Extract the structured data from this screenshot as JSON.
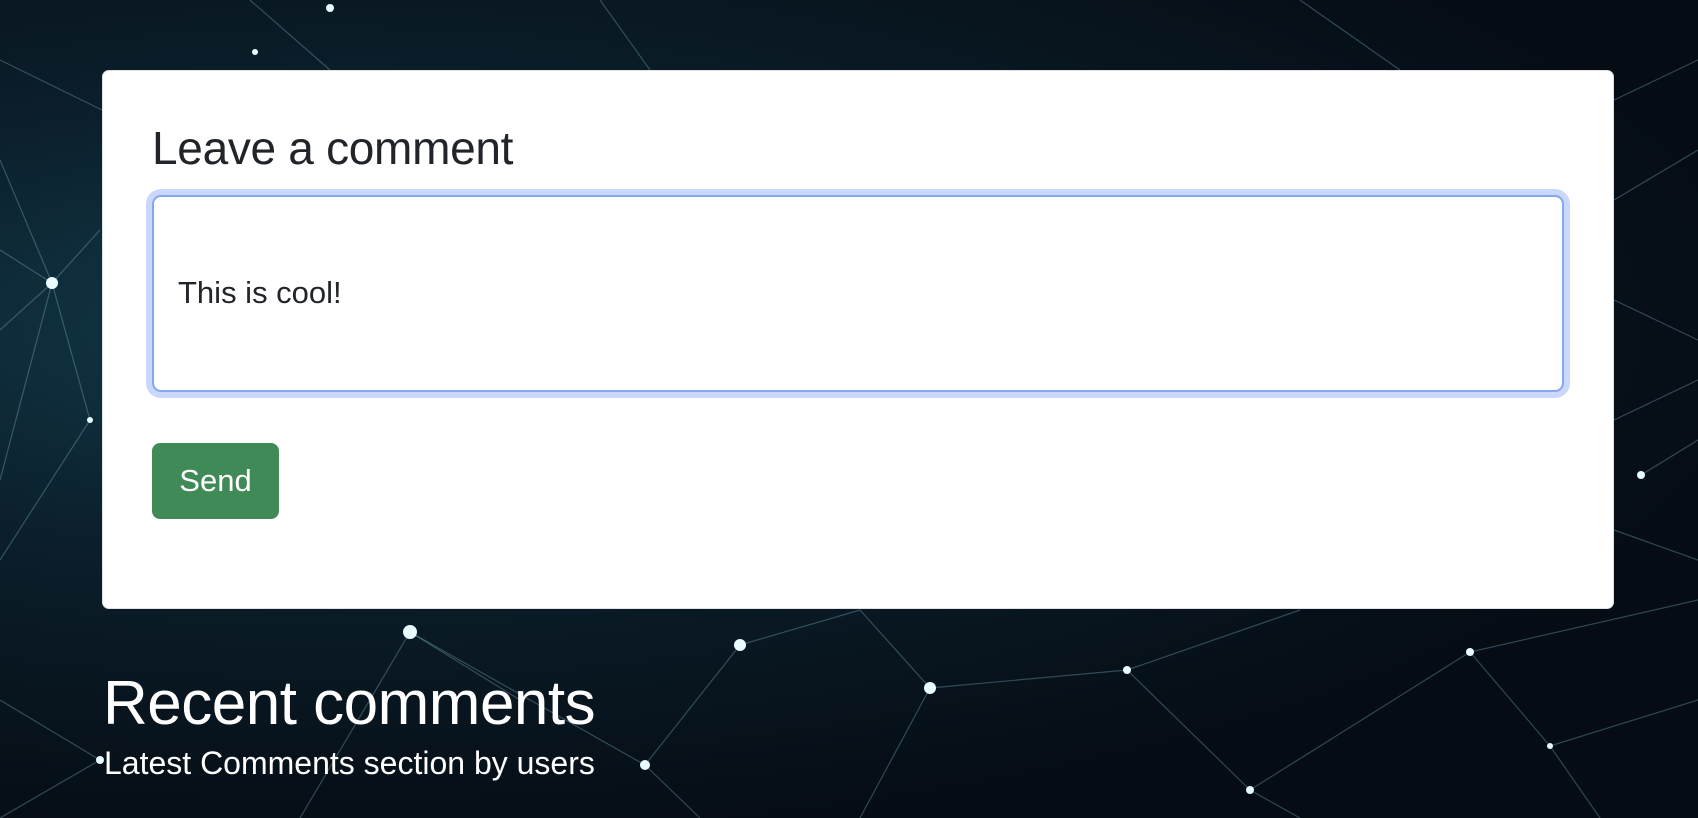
{
  "comment_form": {
    "title": "Leave a comment",
    "comment_value": "This is cool!",
    "send_label": "Send"
  },
  "recent_comments": {
    "title": "Recent comments",
    "subtitle": "Latest Comments section by users"
  },
  "colors": {
    "send_button": "#3f8a56",
    "focus_ring": "#c9d8fb",
    "background": "#050c14"
  }
}
